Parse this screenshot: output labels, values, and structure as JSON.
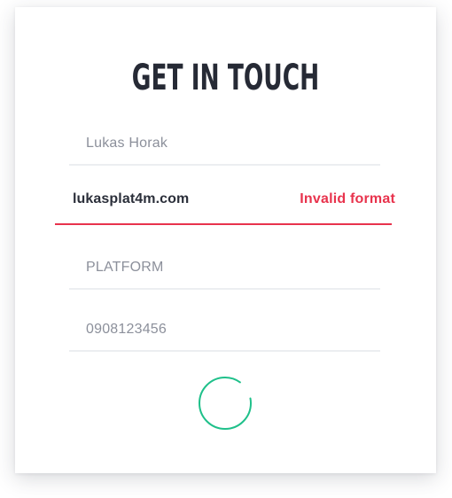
{
  "form": {
    "title": "GET IN TOUCH",
    "fields": [
      {
        "value": "Lukas Horak"
      },
      {
        "value": "lukasplat4m.com",
        "error": "Invalid format"
      },
      {
        "value": "PLATFORM"
      },
      {
        "value": "0908123456"
      }
    ],
    "loading": true
  },
  "colors": {
    "title": "#262a35",
    "placeholder": "#8c909b",
    "error": "#e8334d",
    "spinner": "#1fc08a",
    "underline": "#eceef1"
  }
}
